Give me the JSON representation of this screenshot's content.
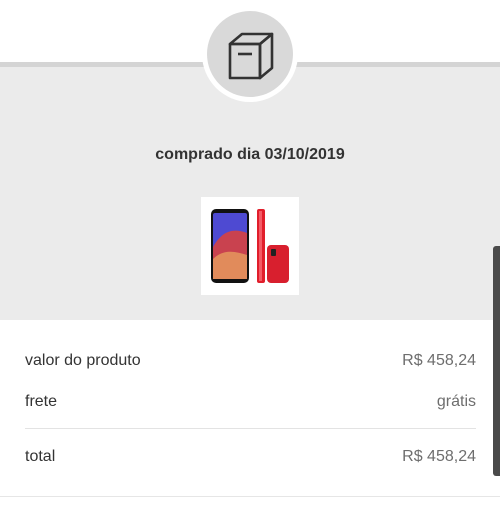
{
  "order": {
    "icon": "package-box-icon",
    "purchased_date": "comprado dia 03/10/2019",
    "product_image": "red-samsung-smartphone"
  },
  "summary": {
    "product_value_label": "valor do produto",
    "product_value": "R$ 458,24",
    "shipping_label": "frete",
    "shipping_value": "grátis",
    "total_label": "total",
    "total_value": "R$ 458,24"
  },
  "colors": {
    "panel_background": "#ebebeb",
    "icon_circle": "#d9d9d9",
    "phone_red": "#d81f2e"
  }
}
